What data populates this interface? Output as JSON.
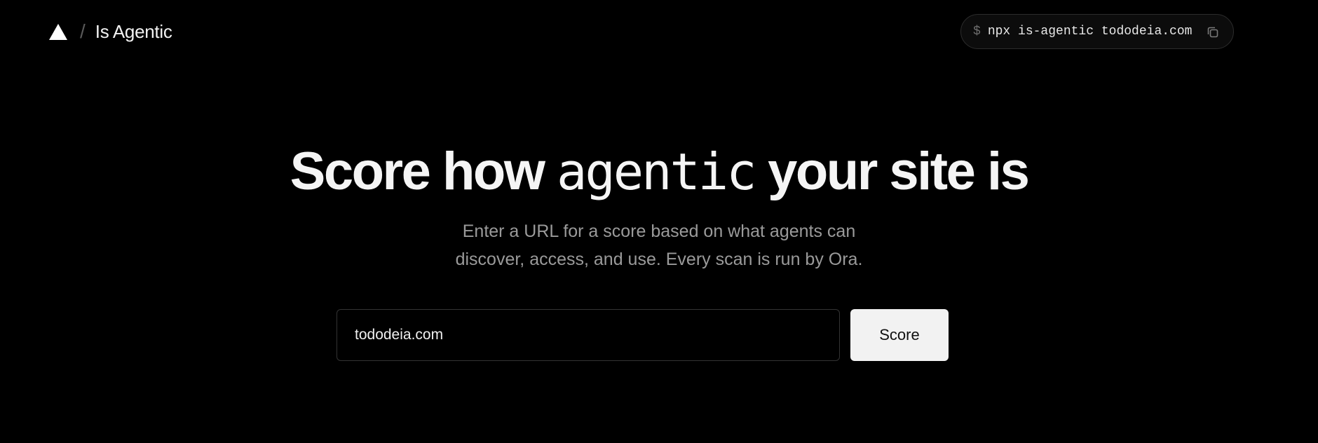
{
  "header": {
    "logo_icon": "triangle-logo-icon",
    "separator": "/",
    "brand_name": "Is Agentic",
    "command": {
      "prompt": "$",
      "text": "npx is-agentic tododeia.com",
      "copy_icon": "copy-icon"
    }
  },
  "hero": {
    "headline_before": "Score how ",
    "headline_highlight": "agentic",
    "headline_after": " your site is",
    "subtitle_line1": "Enter a URL for a score based on what agents can",
    "subtitle_line2": "discover, access, and use. Every scan is run by Ora."
  },
  "form": {
    "url_value": "tododeia.com",
    "submit_label": "Score"
  },
  "colors": {
    "background": "#000000",
    "text_primary": "#f5f5f5",
    "text_muted": "#9a9a9a",
    "button_bg": "#f2f2f2",
    "border": "#333333"
  }
}
